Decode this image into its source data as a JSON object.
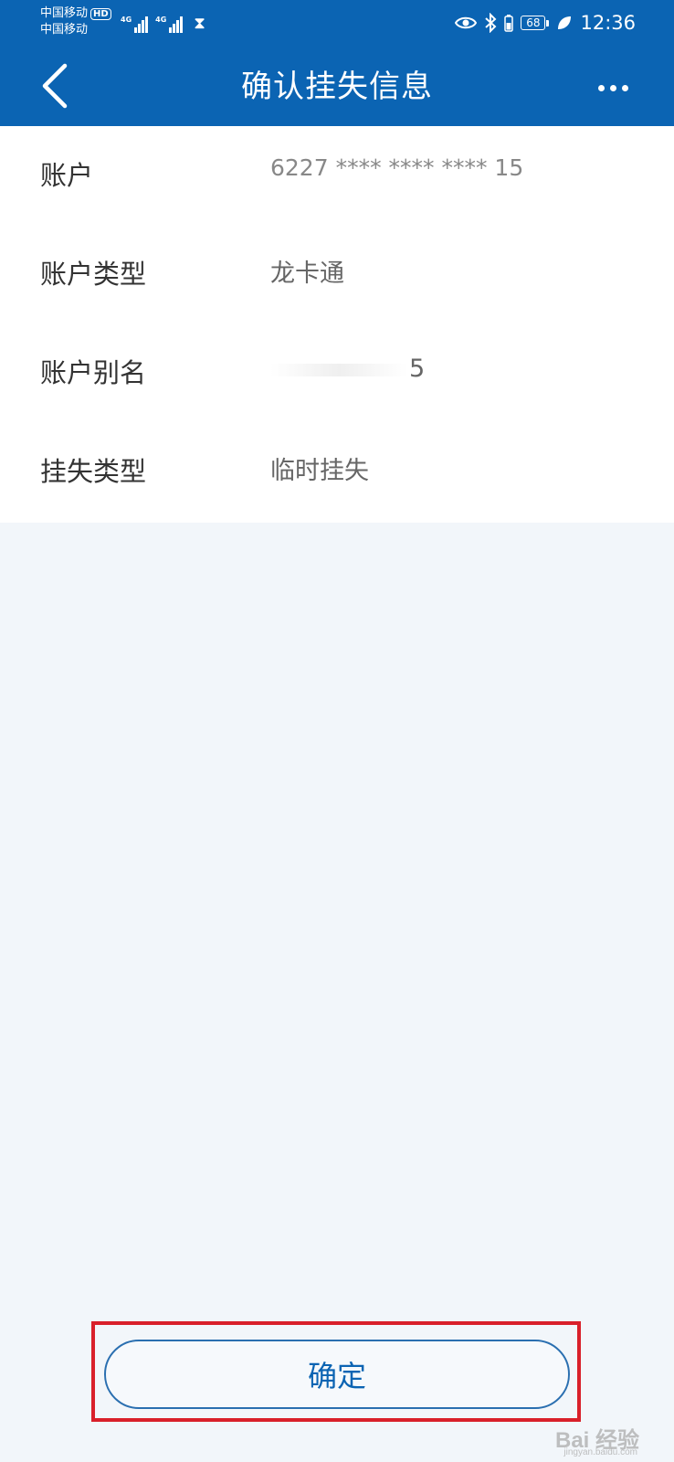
{
  "status_bar": {
    "carrier_1": "中国移动",
    "carrier_2": "中国移动",
    "hd_badge": "HD",
    "network_1": "4G",
    "network_2": "4G",
    "battery": "68",
    "time": "12:36"
  },
  "header": {
    "title": "确认挂失信息",
    "back_icon": "chevron-left-icon",
    "more_icon": "more-horizontal-icon"
  },
  "info": [
    {
      "label": "账户",
      "value": "6227 **** **** **** 15"
    },
    {
      "label": "账户类型",
      "value": "龙卡通"
    },
    {
      "label": "账户别名",
      "value": "5"
    },
    {
      "label": "挂失类型",
      "value": "临时挂失"
    }
  ],
  "actions": {
    "confirm_label": "确定"
  },
  "watermark": {
    "main": "Bai 经验",
    "sub": "jingyan.baidu.com"
  },
  "colors": {
    "header_bg": "#0b64b3",
    "page_bg": "#f2f6fa",
    "highlight_border": "#d9202a",
    "button_text": "#0b64b3"
  }
}
